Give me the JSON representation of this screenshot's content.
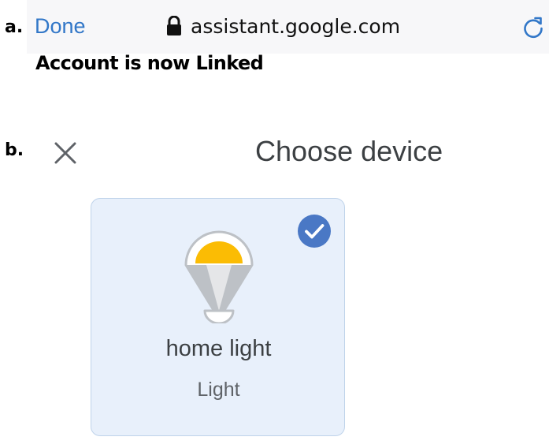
{
  "panel_a": {
    "label": "a.",
    "browser": {
      "done_label": "Done",
      "url": "assistant.google.com",
      "lock_icon": "lock-icon",
      "reload_icon": "reload-icon"
    },
    "message": "Account is now Linked"
  },
  "panel_b": {
    "label": "b.",
    "close_icon": "close-icon",
    "title": "Choose device",
    "device": {
      "name": "home light",
      "type": "Light",
      "selected": true,
      "icon": "light-bulb-icon"
    }
  },
  "colors": {
    "link": "#3277c8",
    "card_background": "#e8f0fb",
    "card_border": "#bfd3ea",
    "check_badge": "#4a78c5",
    "bulb_glow": "#fbbc04",
    "bulb_body": "#bdc1c6"
  }
}
